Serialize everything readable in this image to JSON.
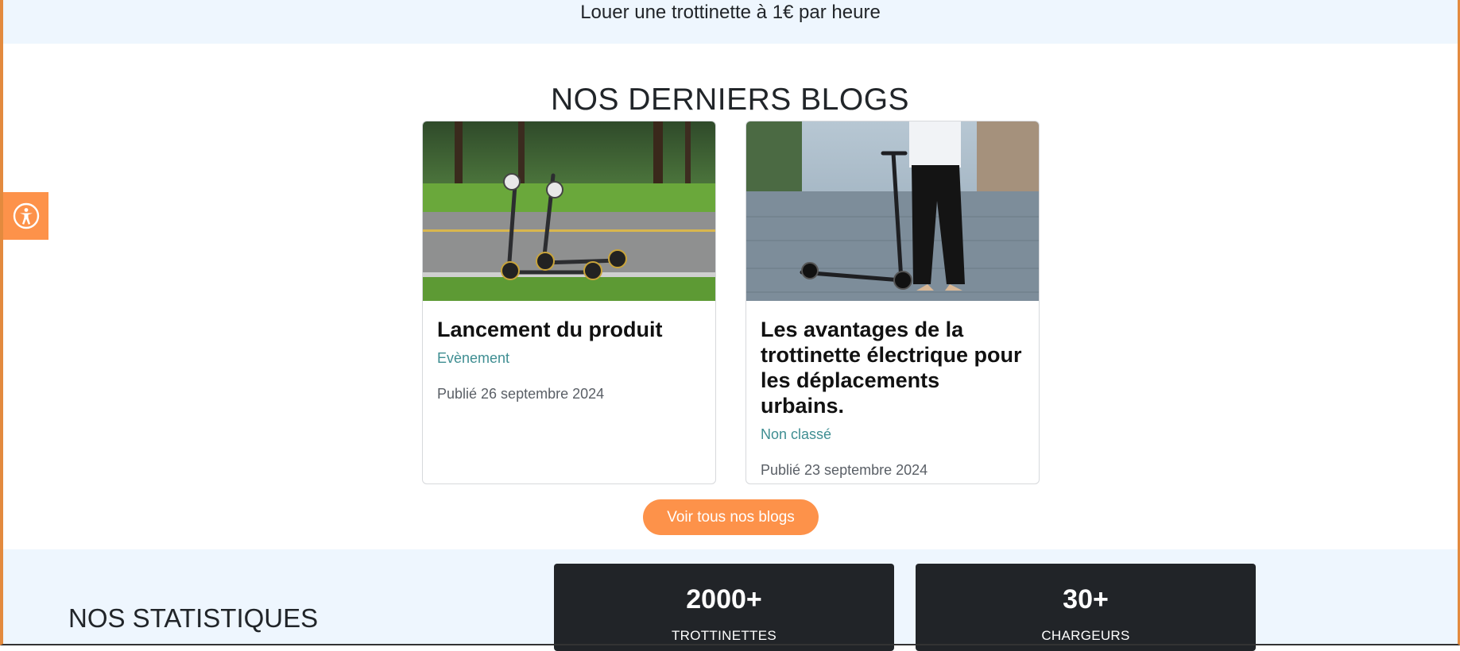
{
  "promo_bar": {
    "text": "Louer une trottinette à 1€ par heure"
  },
  "accessibility": {
    "icon": "accessibility-icon",
    "color": "#fd924a"
  },
  "blogs": {
    "title": "NOS DERNIERS BLOGS",
    "posts": [
      {
        "title": "Lancement du produit",
        "category": "Evènement",
        "date": "Publié 26 septembre 2024",
        "image": "two-scooters-on-park-road"
      },
      {
        "title": "Les avantages de la trottinette électrique pour les déplacements urbains.",
        "category": "Non classé",
        "date": "Publié 23 septembre 2024",
        "image": "person-with-scooter-on-street"
      }
    ],
    "cta_label": "Voir tous nos blogs"
  },
  "stats": {
    "title": "NOS STATISTIQUES",
    "items": [
      {
        "value": "2000+",
        "label": "TROTTINETTES"
      },
      {
        "value": "30+",
        "label": "CHARGEURS"
      }
    ]
  },
  "colors": {
    "accent": "#fd924a",
    "category": "#3f8e92",
    "stat_bg": "#212428",
    "band_bg": "#eef6fe"
  }
}
